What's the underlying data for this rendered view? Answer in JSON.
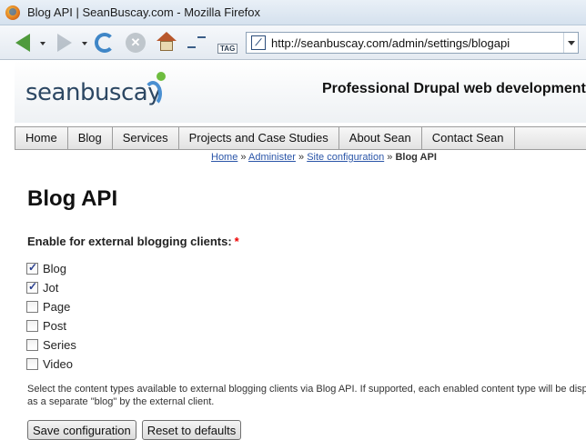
{
  "window": {
    "title": "Blog API | SeanBuscay.com - Mozilla Firefox"
  },
  "toolbar": {
    "url": "http://seanbuscay.com/admin/settings/blogapi",
    "tag_label": "TAG"
  },
  "site": {
    "logo_text": "seanbuscay",
    "tagline": "Professional Drupal web development"
  },
  "menu": {
    "items": [
      {
        "label": "Home"
      },
      {
        "label": "Blog"
      },
      {
        "label": "Services"
      },
      {
        "label": "Projects and Case Studies"
      },
      {
        "label": "About Sean"
      },
      {
        "label": "Contact Sean"
      }
    ]
  },
  "breadcrumb": {
    "items": [
      {
        "label": "Home"
      },
      {
        "label": "Administer"
      },
      {
        "label": "Site configuration"
      }
    ],
    "separator": "»",
    "current": "Blog API"
  },
  "page": {
    "title": "Blog API",
    "field_label": "Enable for external blogging clients:",
    "required_marker": "*",
    "content_types": [
      {
        "label": "Blog",
        "checked": true
      },
      {
        "label": "Jot",
        "checked": true
      },
      {
        "label": "Page",
        "checked": false
      },
      {
        "label": "Post",
        "checked": false
      },
      {
        "label": "Series",
        "checked": false
      },
      {
        "label": "Video",
        "checked": false
      }
    ],
    "description_line1": "Select the content types available to external blogging clients via Blog API. If supported, each enabled content type will be displayed",
    "description_line2": "as a separate \"blog\" by the external client.",
    "save_label": "Save configuration",
    "reset_label": "Reset to defaults"
  }
}
